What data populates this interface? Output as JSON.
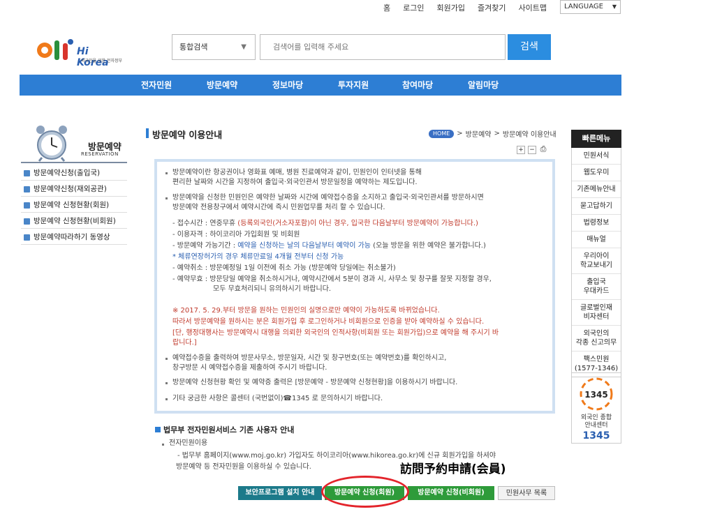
{
  "util_links": [
    "홈",
    "로그인",
    "회원가입",
    "즐겨찾기",
    "사이트맵"
  ],
  "language": "LANGUAGE",
  "logo": {
    "text": "Hi Korea",
    "sub": "외국인을 위한 전자정부"
  },
  "search": {
    "scope": "통합검색",
    "placeholder": "검색어를 입력해 주세요",
    "button": "검색"
  },
  "nav": [
    "전자민원",
    "방문예약",
    "정보마당",
    "투자지원",
    "참여마당",
    "알림마당"
  ],
  "sidebar": {
    "title": "방문예약",
    "subtitle": "RESERVATION",
    "items": [
      "방문예약신청(출입국)",
      "방문예약신청(재외공관)",
      "방문예약 신청현황(회원)",
      "방문예약 신청현황(비회원)",
      "방문예약따라하기 동영상"
    ]
  },
  "page": {
    "title": "방문예약 이용안내",
    "breadcrumb": {
      "home": "HOME",
      "sep": ">",
      "level1": "방문예약",
      "level2": "방문예약 이용안내"
    }
  },
  "content": {
    "p1a": "방문예약이란 항공권이나 영화표 예매, 병원 진료예약과 같이, 민원인이 인터넷을 통해",
    "p1b": "편리한 날짜와 시간을 지정하여 출입국·외국인관서 방문일정을 예약하는 제도입니다.",
    "p2a": "방문예약을 신청한 민원인은 예약한 날짜와 시간에 예약접수증을 소지하고 출입국·외국인관서를 방문하시면",
    "p2b": "방문예약 전용창구에서 예약시간에 즉시 민원업무를 처리 할 수 있습니다.",
    "d1_label": "- 접수시간 : 연중무휴 ",
    "d1_red": "(등록외국인(거소자포함)이 아닌 경우, 입국한 다음날부터 방문예약이 가능합니다.)",
    "d2": "- 이용자격 : 하이코리아 가입회원 및 비회원",
    "d3_label": "- 방문예약 가능기간 : ",
    "d3_blue": "예약을 신청하는 날의 다음날부터 예약이 가능",
    "d3_tail": " (오늘 방문을 위한 예약은 불가합니다.)",
    "d4": "* 체류연장허가의 경우 체류만료일 4개월 전부터 신청 가능",
    "d5": "- 예약취소 : 방문예정일 1일 이전에 취소 가능 (방문예약 당일에는 취소불가)",
    "d6a": "- 예약무효 : 방문당일 예약을 취소하시거나, 예약시간에서 5분이 경과 시, 사무소 및 창구를 잘못 지정할 경우,",
    "d6b": "모두 무효처리되니 유의하시기 바랍니다.",
    "n1": "※ 2017. 5. 29.부터 방문을 원하는 민원인의 실명으로만 예약이 가능하도록 바뀌었습니다.",
    "n2": "따라서 방문예약을 원하시는 분은 회원가입 후 로그인하거나 비회원으로 인증을 받아 예약하실 수 있습니다.",
    "n3a": "[단, 행정대행사는 방문예약시 대행을 의뢰한 외국인의 인적사항(비회원 또는 회원가입)으로 예약을 해 주시기 바",
    "n3b": "랍니다.]",
    "p3a": "예약접수증을 출력하여 방문사무소, 방문일자, 시간 및 창구번호(또는 예약번호)를 확인하시고,",
    "p3b": "창구방문 시 예약접수증을 제출하여 주시기 바랍니다.",
    "p4": "방문예약 신청현황 확인 및 예약증 출력은 [방문예약 - 방문예약 신청현황]을 이용하시기 바랍니다.",
    "p5": "기타 궁금한 사항은 콜센터 (국번없이)☎1345 로 문의하시기 바랍니다."
  },
  "moj": {
    "title": "법무부 전자민원서비스 기존 사용자 안내",
    "item": "전자민원이용",
    "desc_a": "- 법무부 홈페이지(www.moj.go.kr) 가입자도 하이코리아(www.hikorea.go.kr)에 신규 회원가입을 하셔야",
    "desc_b": "방문예약 등 전자민원을 이용하실 수 있습니다."
  },
  "annotation": "訪問予約申請(会員)",
  "buttons": [
    "보안프로그램 설치 안내",
    "방문예약 신청(회원)",
    "방문예약 신청(비회원)",
    "민원사무 목록"
  ],
  "quick_menu": {
    "title": "빠른메뉴",
    "items": [
      "민원서식",
      "웹도우미",
      "기존메뉴안내",
      "묻고답하기",
      "법령정보",
      "매뉴얼",
      "우리아이\n학교보내기",
      "출입국\n우대카드",
      "글로벌인재\n비자센터",
      "외국인의\n각종 신고의무",
      "팩스민원\n(1577-1346)"
    ]
  },
  "center": {
    "number_badge": "1345",
    "label_a": "외국인 종합",
    "label_b": "안내센터",
    "number": "1345"
  },
  "colors": {
    "nav": "#2d7ed4",
    "search_btn": "#2b8de0",
    "btn_green": "#2e9b3a",
    "btn_blue": "#1c7a8a",
    "annotation_circle": "#e3242b"
  }
}
